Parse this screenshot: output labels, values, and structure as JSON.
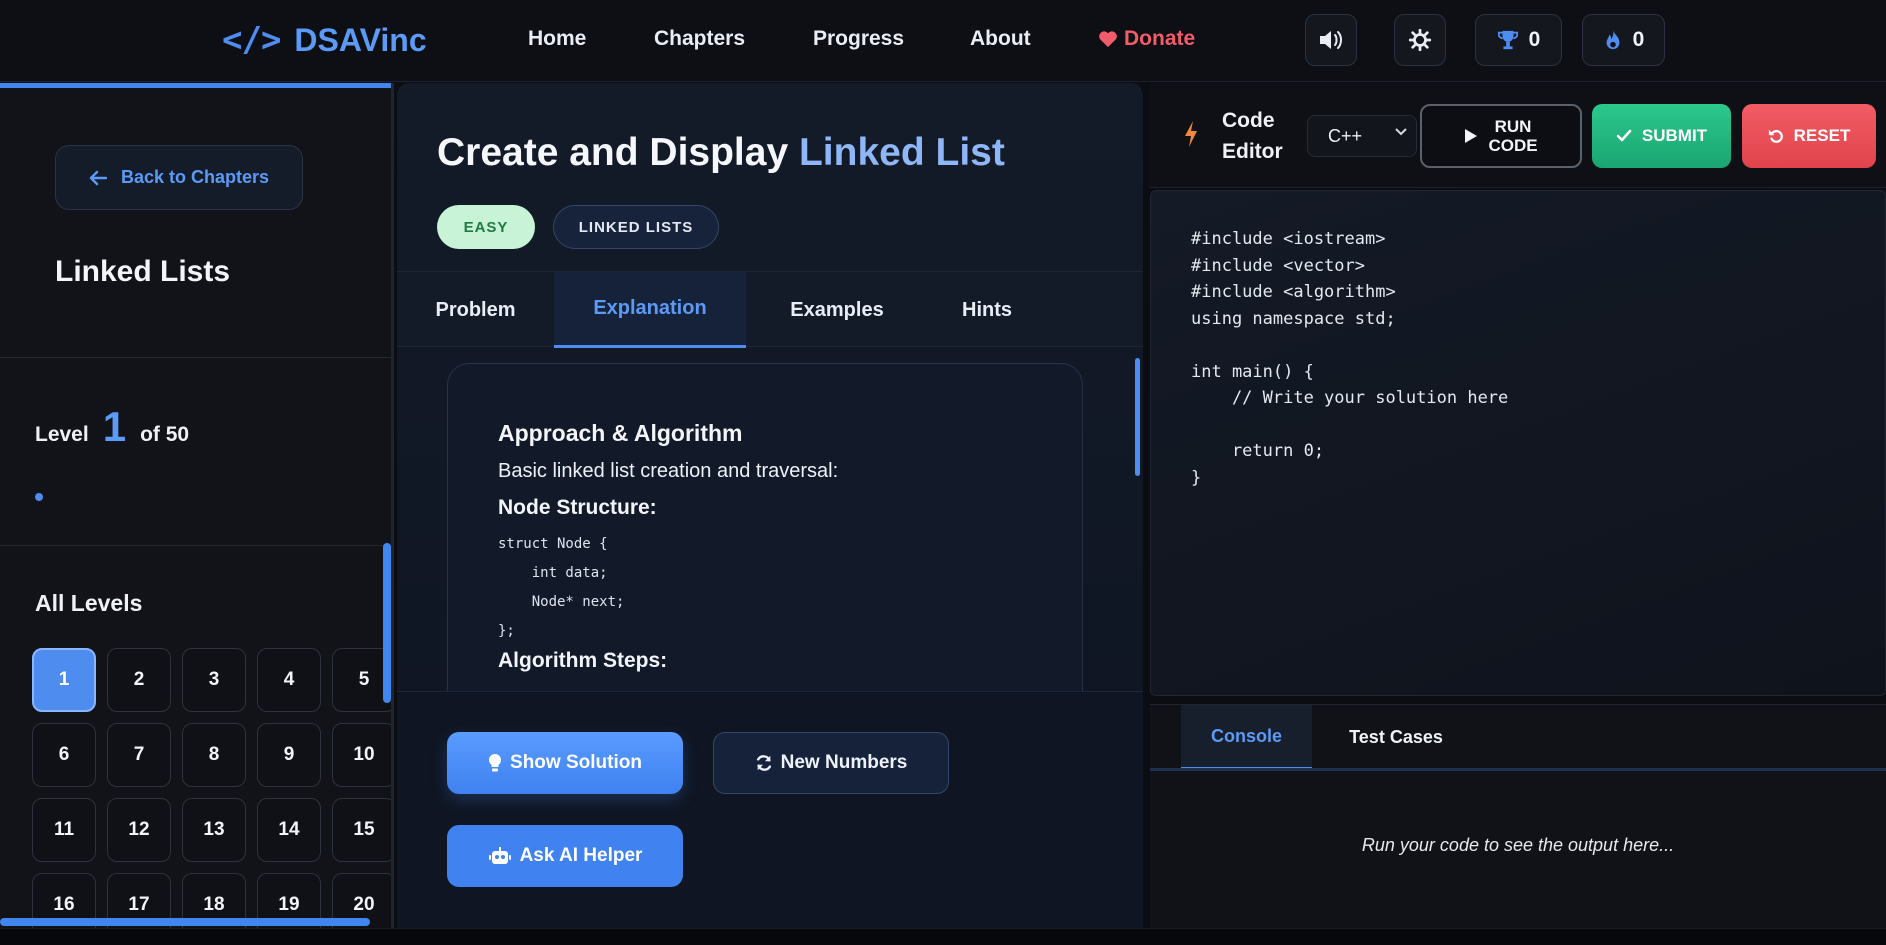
{
  "navbar": {
    "brand_icon": "</>",
    "brand": "DSAVinc",
    "links": [
      "Home",
      "Chapters",
      "Progress",
      "About"
    ],
    "donate": "Donate",
    "trophy_count": "0",
    "streak_count": "0",
    "icons": [
      "volume-icon",
      "settings-icon",
      "trophy-icon",
      "fire-icon"
    ]
  },
  "sidebar": {
    "back_label": "Back to Chapters",
    "chapter_title": "Linked Lists",
    "level_prefix": "Level",
    "current_level": "1",
    "level_suffix": "of 50",
    "level_progress": 0.02,
    "all_levels_label": "All Levels",
    "levels": [
      "1",
      "2",
      "3",
      "4",
      "5",
      "6",
      "7",
      "8",
      "9",
      "10",
      "11",
      "12",
      "13",
      "14",
      "15",
      "16",
      "17",
      "18",
      "19",
      "20"
    ],
    "active_level": "1"
  },
  "problem": {
    "title_part1": "Create and Display",
    "title_part2": "Linked List",
    "difficulty": "EASY",
    "topic": "LINKED LISTS",
    "tabs": [
      "Problem",
      "Explanation",
      "Examples",
      "Hints"
    ],
    "active_tab": "Explanation",
    "explanation": {
      "heading": "Approach & Algorithm",
      "intro": "Basic linked list creation and traversal:",
      "node_heading": "Node Structure:",
      "code": [
        "struct Node {",
        "    int data;",
        "    Node* next;",
        "};"
      ],
      "steps_heading": "Algorithm Steps:"
    },
    "actions": {
      "show_solution": "Show Solution",
      "new_numbers": "New Numbers",
      "ask_ai": "Ask AI Helper"
    }
  },
  "editor": {
    "label_line1": "Code",
    "label_line2": "Editor",
    "language": "C++",
    "run_line1": "RUN",
    "run_line2": "CODE",
    "submit": "SUBMIT",
    "reset": "RESET",
    "code": [
      "#include <iostream>",
      "#include <vector>",
      "#include <algorithm>",
      "using namespace std;",
      "",
      "int main() {",
      "    // Write your solution here",
      "",
      "    return 0;",
      "}"
    ]
  },
  "console": {
    "tabs": [
      "Console",
      "Test Cases"
    ],
    "active_tab": "Console",
    "placeholder": "Run your code to see the output here..."
  },
  "colors": {
    "accent": "#4f8cf0",
    "success": "#1aa572",
    "danger": "#e0434c",
    "easy_bg": "#c9f3d7"
  }
}
